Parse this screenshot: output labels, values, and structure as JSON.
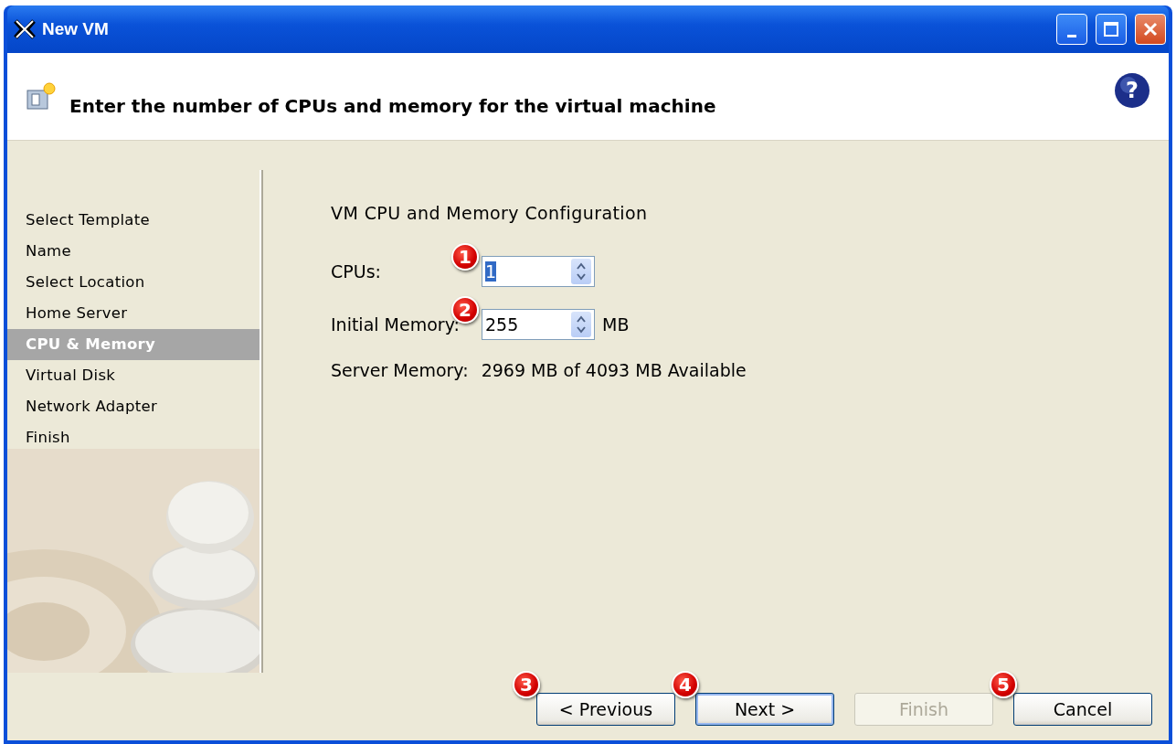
{
  "window": {
    "title": "New VM"
  },
  "header": {
    "text": "Enter the number of CPUs and memory for the virtual machine",
    "help": "?"
  },
  "sidebar": {
    "items": [
      {
        "label": "Select Template",
        "selected": false
      },
      {
        "label": "Name",
        "selected": false
      },
      {
        "label": "Select Location",
        "selected": false
      },
      {
        "label": "Home Server",
        "selected": false
      },
      {
        "label": "CPU & Memory",
        "selected": true
      },
      {
        "label": "Virtual Disk",
        "selected": false
      },
      {
        "label": "Network Adapter",
        "selected": false
      },
      {
        "label": "Finish",
        "selected": false
      }
    ]
  },
  "content": {
    "heading": "VM CPU and Memory Configuration",
    "fields": [
      {
        "label": "CPUs:",
        "value": "1",
        "focused": true,
        "badge": "1"
      },
      {
        "label": "Initial Memory:",
        "value": "255",
        "focused": false,
        "unit": "MB",
        "badge": "2"
      }
    ],
    "server_memory": {
      "label": "Server Memory:",
      "value": "2969 MB of 4093 MB Available"
    }
  },
  "buttons": [
    {
      "label": "< Previous",
      "disabled": false,
      "default": false,
      "badge": "3"
    },
    {
      "label": "Next >",
      "disabled": false,
      "default": true,
      "badge": "4"
    },
    {
      "label": "Finish",
      "disabled": true,
      "default": false
    },
    {
      "label": "Cancel",
      "disabled": false,
      "default": false,
      "badge": "5"
    }
  ]
}
